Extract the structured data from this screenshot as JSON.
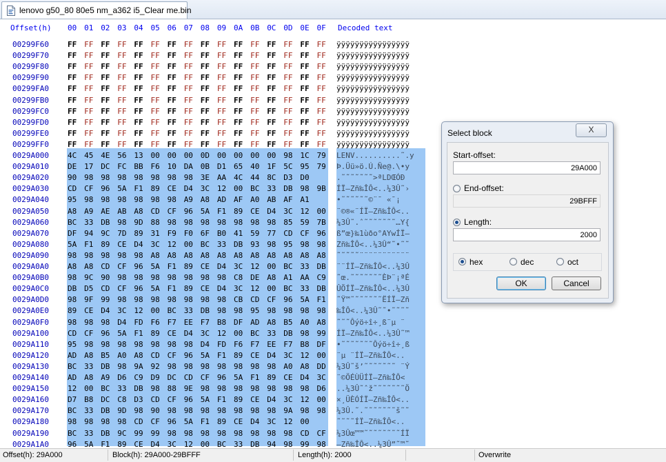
{
  "tab": {
    "title": "lenovo g50_80 80e5 nm_a362 i5_Clear me.bin",
    "icon": "binary-file-icon"
  },
  "header": {
    "offset_label": "Offset(h)",
    "columns": [
      "00",
      "01",
      "02",
      "03",
      "04",
      "05",
      "06",
      "07",
      "08",
      "09",
      "0A",
      "0B",
      "0C",
      "0D",
      "0E",
      "0F"
    ],
    "decoded_label": "Decoded text"
  },
  "rows": [
    {
      "offset": "00299F60",
      "bytes": [
        "FF",
        "FF",
        "FF",
        "FF",
        "FF",
        "FF",
        "FF",
        "FF",
        "FF",
        "FF",
        "FF",
        "FF",
        "FF",
        "FF",
        "FF",
        "FF"
      ],
      "decoded": "ÿÿÿÿÿÿÿÿÿÿÿÿÿÿÿÿ",
      "selected": false
    },
    {
      "offset": "00299F70",
      "bytes": [
        "FF",
        "FF",
        "FF",
        "FF",
        "FF",
        "FF",
        "FF",
        "FF",
        "FF",
        "FF",
        "FF",
        "FF",
        "FF",
        "FF",
        "FF",
        "FF"
      ],
      "decoded": "ÿÿÿÿÿÿÿÿÿÿÿÿÿÿÿÿ",
      "selected": false
    },
    {
      "offset": "00299F80",
      "bytes": [
        "FF",
        "FF",
        "FF",
        "FF",
        "FF",
        "FF",
        "FF",
        "FF",
        "FF",
        "FF",
        "FF",
        "FF",
        "FF",
        "FF",
        "FF",
        "FF"
      ],
      "decoded": "ÿÿÿÿÿÿÿÿÿÿÿÿÿÿÿÿ",
      "selected": false
    },
    {
      "offset": "00299F90",
      "bytes": [
        "FF",
        "FF",
        "FF",
        "FF",
        "FF",
        "FF",
        "FF",
        "FF",
        "FF",
        "FF",
        "FF",
        "FF",
        "FF",
        "FF",
        "FF",
        "FF"
      ],
      "decoded": "ÿÿÿÿÿÿÿÿÿÿÿÿÿÿÿÿ",
      "selected": false
    },
    {
      "offset": "00299FA0",
      "bytes": [
        "FF",
        "FF",
        "FF",
        "FF",
        "FF",
        "FF",
        "FF",
        "FF",
        "FF",
        "FF",
        "FF",
        "FF",
        "FF",
        "FF",
        "FF",
        "FF"
      ],
      "decoded": "ÿÿÿÿÿÿÿÿÿÿÿÿÿÿÿÿ",
      "selected": false
    },
    {
      "offset": "00299FB0",
      "bytes": [
        "FF",
        "FF",
        "FF",
        "FF",
        "FF",
        "FF",
        "FF",
        "FF",
        "FF",
        "FF",
        "FF",
        "FF",
        "FF",
        "FF",
        "FF",
        "FF"
      ],
      "decoded": "ÿÿÿÿÿÿÿÿÿÿÿÿÿÿÿÿ",
      "selected": false
    },
    {
      "offset": "00299FC0",
      "bytes": [
        "FF",
        "FF",
        "FF",
        "FF",
        "FF",
        "FF",
        "FF",
        "FF",
        "FF",
        "FF",
        "FF",
        "FF",
        "FF",
        "FF",
        "FF",
        "FF"
      ],
      "decoded": "ÿÿÿÿÿÿÿÿÿÿÿÿÿÿÿÿ",
      "selected": false
    },
    {
      "offset": "00299FD0",
      "bytes": [
        "FF",
        "FF",
        "FF",
        "FF",
        "FF",
        "FF",
        "FF",
        "FF",
        "FF",
        "FF",
        "FF",
        "FF",
        "FF",
        "FF",
        "FF",
        "FF"
      ],
      "decoded": "ÿÿÿÿÿÿÿÿÿÿÿÿÿÿÿÿ",
      "selected": false
    },
    {
      "offset": "00299FE0",
      "bytes": [
        "FF",
        "FF",
        "FF",
        "FF",
        "FF",
        "FF",
        "FF",
        "FF",
        "FF",
        "FF",
        "FF",
        "FF",
        "FF",
        "FF",
        "FF",
        "FF"
      ],
      "decoded": "ÿÿÿÿÿÿÿÿÿÿÿÿÿÿÿÿ",
      "selected": false
    },
    {
      "offset": "00299FF0",
      "bytes": [
        "FF",
        "FF",
        "FF",
        "FF",
        "FF",
        "FF",
        "FF",
        "FF",
        "FF",
        "FF",
        "FF",
        "FF",
        "FF",
        "FF",
        "FF",
        "FF"
      ],
      "decoded": "ÿÿÿÿÿÿÿÿÿÿÿÿÿÿÿÿ",
      "selected": false
    },
    {
      "offset": "0029A000",
      "bytes": [
        "4C",
        "45",
        "4E",
        "56",
        "13",
        "00",
        "00",
        "00",
        "0D",
        "00",
        "00",
        "00",
        "00",
        "98",
        "1C",
        "79"
      ],
      "decoded": "LENV..........˜.y",
      "selected": true
    },
    {
      "offset": "0029A010",
      "bytes": [
        "DE",
        "17",
        "DC",
        "FC",
        "BB",
        "F6",
        "10",
        "DA",
        "0B",
        "D1",
        "65",
        "40",
        "1F",
        "5C",
        "95",
        "79"
      ],
      "decoded": "Þ.Üü»ö.Ú.Ñe@.\\•y",
      "selected": true
    },
    {
      "offset": "0029A020",
      "bytes": [
        "90",
        "98",
        "98",
        "98",
        "98",
        "98",
        "98",
        "98",
        "3E",
        "AA",
        "4C",
        "44",
        "8C",
        "D3",
        "D0"
      ],
      "decoded": ".˜˜˜˜˜˜˜>ªLDŒÓÐ",
      "selected": true
    },
    {
      "offset": "0029A030",
      "bytes": [
        "CD",
        "CF",
        "96",
        "5A",
        "F1",
        "89",
        "CE",
        "D4",
        "3C",
        "12",
        "00",
        "BC",
        "33",
        "DB",
        "98",
        "9B"
      ],
      "decoded": "ÍÏ–Zñ‰ÎÔ<..¼3Û˜›",
      "selected": true
    },
    {
      "offset": "0029A040",
      "bytes": [
        "95",
        "98",
        "98",
        "98",
        "98",
        "98",
        "98",
        "A9",
        "A8",
        "AD",
        "AF",
        "A0",
        "AB",
        "AF",
        "A1"
      ],
      "decoded": "•˜˜˜˜˜˜©¨­¯ «¯¡",
      "selected": true
    },
    {
      "offset": "0029A050",
      "bytes": [
        "A8",
        "A9",
        "AE",
        "AB",
        "A8",
        "CD",
        "CF",
        "96",
        "5A",
        "F1",
        "89",
        "CE",
        "D4",
        "3C",
        "12",
        "00"
      ],
      "decoded": "¨©®«¨ÍÏ–Zñ‰ÎÔ<..",
      "selected": true
    },
    {
      "offset": "0029A060",
      "bytes": [
        "BC",
        "33",
        "DB",
        "98",
        "9D",
        "88",
        "98",
        "98",
        "98",
        "98",
        "98",
        "98",
        "98",
        "85",
        "59",
        "7B"
      ],
      "decoded": "¼3Û˜.ˆ˜˜˜˜˜˜˜…Y{",
      "selected": true
    },
    {
      "offset": "0029A070",
      "bytes": [
        "DF",
        "94",
        "9C",
        "7D",
        "89",
        "31",
        "F9",
        "F0",
        "6F",
        "B0",
        "41",
        "59",
        "77",
        "CD",
        "CF",
        "96"
      ],
      "decoded": "ß”œ}‰1ùðo°AYwÍÏ–",
      "selected": true
    },
    {
      "offset": "0029A080",
      "bytes": [
        "5A",
        "F1",
        "89",
        "CE",
        "D4",
        "3C",
        "12",
        "00",
        "BC",
        "33",
        "DB",
        "93",
        "98",
        "95",
        "98",
        "98"
      ],
      "decoded": "Zñ‰ÎÔ<..¼3Û“˜•˜˜",
      "selected": true
    },
    {
      "offset": "0029A090",
      "bytes": [
        "98",
        "98",
        "98",
        "98",
        "98",
        "A8",
        "A8",
        "A8",
        "A8",
        "A8",
        "A8",
        "A8",
        "A8",
        "A8",
        "A8",
        "A8"
      ],
      "decoded": "˜˜˜˜˜¨¨¨¨¨¨¨¨¨¨¨",
      "selected": true
    },
    {
      "offset": "0029A0A0",
      "bytes": [
        "A8",
        "A8",
        "CD",
        "CF",
        "96",
        "5A",
        "F1",
        "89",
        "CE",
        "D4",
        "3C",
        "12",
        "00",
        "BC",
        "33",
        "DB"
      ],
      "decoded": "¨¨ÍÏ–Zñ‰ÎÔ<..¼3Û",
      "selected": true
    },
    {
      "offset": "0029A0B0",
      "bytes": [
        "98",
        "9C",
        "90",
        "98",
        "98",
        "98",
        "98",
        "98",
        "98",
        "98",
        "C8",
        "DE",
        "A8",
        "A1",
        "AA",
        "C9"
      ],
      "decoded": "˜œ.˜˜˜˜˜˜˜ÈÞ¨¡ªÉ",
      "selected": true
    },
    {
      "offset": "0029A0C0",
      "bytes": [
        "DB",
        "D5",
        "CD",
        "CF",
        "96",
        "5A",
        "F1",
        "89",
        "CE",
        "D4",
        "3C",
        "12",
        "00",
        "BC",
        "33",
        "DB"
      ],
      "decoded": "ÛÕÍÏ–Zñ‰ÎÔ<..¼3Û",
      "selected": true
    },
    {
      "offset": "0029A0D0",
      "bytes": [
        "98",
        "9F",
        "99",
        "98",
        "98",
        "98",
        "98",
        "98",
        "98",
        "98",
        "CB",
        "CD",
        "CF",
        "96",
        "5A",
        "F1"
      ],
      "decoded": "˜Ÿ™˜˜˜˜˜˜˜ËÍÏ–Zñ",
      "selected": true
    },
    {
      "offset": "0029A0E0",
      "bytes": [
        "89",
        "CE",
        "D4",
        "3C",
        "12",
        "00",
        "BC",
        "33",
        "DB",
        "98",
        "98",
        "95",
        "98",
        "98",
        "98",
        "98"
      ],
      "decoded": "‰ÎÔ<..¼3Û˜˜•˜˜˜˜",
      "selected": true
    },
    {
      "offset": "0029A0F0",
      "bytes": [
        "98",
        "98",
        "98",
        "D4",
        "FD",
        "F6",
        "F7",
        "EE",
        "F7",
        "B8",
        "DF",
        "AD",
        "A8",
        "B5",
        "A0",
        "A8"
      ],
      "decoded": "˜˜˜Ôýö÷î÷¸ß­¨µ ¨",
      "selected": true
    },
    {
      "offset": "0029A100",
      "bytes": [
        "CD",
        "CF",
        "96",
        "5A",
        "F1",
        "89",
        "CE",
        "D4",
        "3C",
        "12",
        "00",
        "BC",
        "33",
        "DB",
        "98",
        "99"
      ],
      "decoded": "ÍÏ–Zñ‰ÎÔ<..¼3Û˜™",
      "selected": true
    },
    {
      "offset": "0029A110",
      "bytes": [
        "95",
        "98",
        "98",
        "98",
        "98",
        "98",
        "98",
        "98",
        "D4",
        "FD",
        "F6",
        "F7",
        "EE",
        "F7",
        "B8",
        "DF"
      ],
      "decoded": "•˜˜˜˜˜˜˜Ôýö÷î÷¸ß",
      "selected": true
    },
    {
      "offset": "0029A120",
      "bytes": [
        "AD",
        "A8",
        "B5",
        "A0",
        "A8",
        "CD",
        "CF",
        "96",
        "5A",
        "F1",
        "89",
        "CE",
        "D4",
        "3C",
        "12",
        "00"
      ],
      "decoded": "­¨µ ¨ÍÏ–Zñ‰ÎÔ<..",
      "selected": true
    },
    {
      "offset": "0029A130",
      "bytes": [
        "BC",
        "33",
        "DB",
        "98",
        "9A",
        "92",
        "98",
        "98",
        "98",
        "98",
        "98",
        "98",
        "98",
        "A0",
        "A8",
        "DD"
      ],
      "decoded": "¼3Û˜š’˜˜˜˜˜˜˜ ¨Ý",
      "selected": true
    },
    {
      "offset": "0029A140",
      "bytes": [
        "AD",
        "A8",
        "A9",
        "D6",
        "C9",
        "D9",
        "DC",
        "CD",
        "CF",
        "96",
        "5A",
        "F1",
        "89",
        "CE",
        "D4",
        "3C"
      ],
      "decoded": "­¨©ÖÉÙÜÍÏ–Zñ‰ÎÔ<",
      "selected": true
    },
    {
      "offset": "0029A150",
      "bytes": [
        "12",
        "00",
        "BC",
        "33",
        "DB",
        "98",
        "88",
        "9E",
        "98",
        "98",
        "98",
        "98",
        "98",
        "98",
        "98",
        "D6"
      ],
      "decoded": "..¼3Û˜ˆž˜˜˜˜˜˜˜Ö",
      "selected": true
    },
    {
      "offset": "0029A160",
      "bytes": [
        "D7",
        "B8",
        "DC",
        "C8",
        "D3",
        "CD",
        "CF",
        "96",
        "5A",
        "F1",
        "89",
        "CE",
        "D4",
        "3C",
        "12",
        "00"
      ],
      "decoded": "×¸ÜÈÓÍÏ–Zñ‰ÎÔ<..",
      "selected": true
    },
    {
      "offset": "0029A170",
      "bytes": [
        "BC",
        "33",
        "DB",
        "9D",
        "98",
        "90",
        "98",
        "98",
        "98",
        "98",
        "98",
        "98",
        "98",
        "9A",
        "98",
        "98"
      ],
      "decoded": "¼3Û.˜.˜˜˜˜˜˜˜š˜˜",
      "selected": true
    },
    {
      "offset": "0029A180",
      "bytes": [
        "98",
        "98",
        "98",
        "98",
        "CD",
        "CF",
        "96",
        "5A",
        "F1",
        "89",
        "CE",
        "D4",
        "3C",
        "12",
        "00"
      ],
      "decoded": "˜˜˜˜ÍÏ–Zñ‰ÎÔ<..",
      "selected": true
    },
    {
      "offset": "0029A190",
      "bytes": [
        "BC",
        "33",
        "DB",
        "9C",
        "99",
        "99",
        "98",
        "98",
        "98",
        "98",
        "98",
        "98",
        "98",
        "98",
        "CD",
        "CF"
      ],
      "decoded": "¼3Ûœ™™˜˜˜˜˜˜˜˜ÍÏ",
      "selected": true
    },
    {
      "offset": "0029A1A0",
      "bytes": [
        "96",
        "5A",
        "F1",
        "89",
        "CE",
        "D4",
        "3C",
        "12",
        "00",
        "BC",
        "33",
        "DB",
        "94",
        "98",
        "99",
        "98"
      ],
      "decoded": "–Zñ‰ÎÔ<..¼3Û”˜™˜",
      "selected": true
    }
  ],
  "status_bar": {
    "offset": "Offset(h): 29A000",
    "block": "Block(h): 29A000-29BFFF",
    "length": "Length(h): 2000",
    "mode": "Overwrite"
  },
  "dialog": {
    "title": "Select block",
    "close_label": "X",
    "start_label": "Start-offset:",
    "start_value": "29A000",
    "end_label": "End-offset:",
    "end_value": "29BFFF",
    "length_label": "Length:",
    "length_value": "2000",
    "base_options": [
      "hex",
      "dec",
      "oct"
    ],
    "selected_base": "hex",
    "range_mode": "length",
    "ok_label": "OK",
    "cancel_label": "Cancel"
  }
}
